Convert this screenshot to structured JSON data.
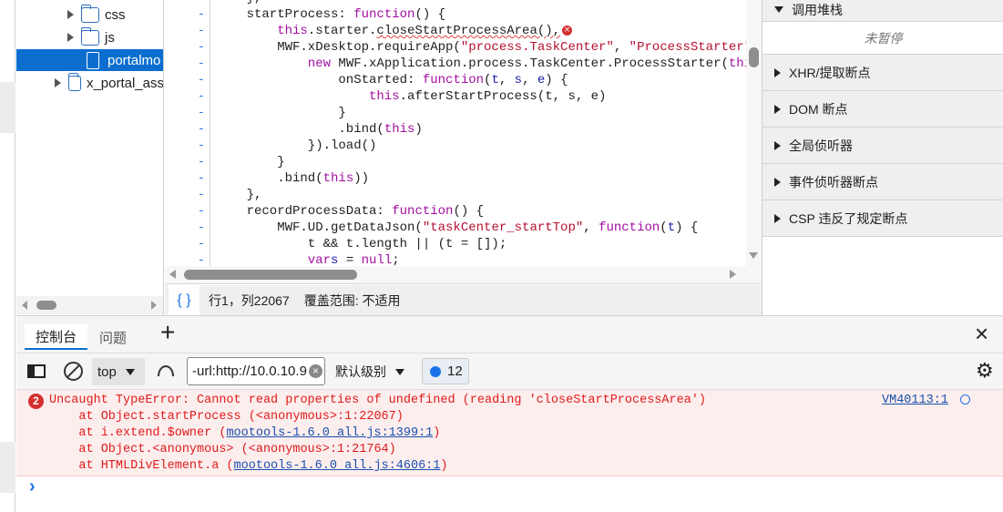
{
  "sidebar": {
    "items": [
      {
        "label": "css",
        "type": "folder"
      },
      {
        "label": "js",
        "type": "folder"
      },
      {
        "label": "portalmo",
        "type": "file"
      },
      {
        "label": "x_portal_ass",
        "type": "folder"
      }
    ]
  },
  "code": {
    "lines": [
      {
        "i": 1,
        "t": [
          [
            "",
            "},"
          ]
        ]
      },
      {
        "i": 1,
        "t": [
          [
            "",
            "startProcess: "
          ],
          [
            "k",
            "function"
          ],
          [
            "",
            "() {"
          ]
        ]
      },
      {
        "i": 2,
        "t": [
          [
            "k",
            "this"
          ],
          [
            "",
            ".starter."
          ],
          [
            "sq",
            "closeStartProcessArea(),"
          ]
        ],
        "err": true
      },
      {
        "i": 2,
        "t": [
          [
            "",
            "MWF.xDesktop.requireApp("
          ],
          [
            "s",
            "\"process.TaskCenter\""
          ],
          [
            "",
            ", "
          ],
          [
            "s",
            "\"ProcessStarter\""
          ]
        ]
      },
      {
        "i": 3,
        "t": [
          [
            "k",
            "new"
          ],
          [
            "",
            " MWF.xApplication.process.TaskCenter.ProcessStarter("
          ],
          [
            "k",
            "thi"
          ]
        ]
      },
      {
        "i": 4,
        "t": [
          [
            "",
            "onStarted: "
          ],
          [
            "k",
            "function"
          ],
          [
            "",
            "("
          ],
          [
            "p",
            "t"
          ],
          [
            "",
            ", "
          ],
          [
            "p",
            "s"
          ],
          [
            "",
            ", "
          ],
          [
            "p",
            "e"
          ],
          [
            "",
            ") {"
          ]
        ]
      },
      {
        "i": 5,
        "t": [
          [
            "k",
            "this"
          ],
          [
            "",
            ".afterStartProcess(t, s, e)"
          ]
        ]
      },
      {
        "i": 4,
        "t": [
          [
            "",
            "}"
          ]
        ]
      },
      {
        "i": 4,
        "t": [
          [
            "",
            ".bind("
          ],
          [
            "k",
            "this"
          ],
          [
            "",
            ")"
          ]
        ]
      },
      {
        "i": 3,
        "t": [
          [
            "",
            "}).load()"
          ]
        ]
      },
      {
        "i": 2,
        "t": [
          [
            "",
            "}"
          ]
        ]
      },
      {
        "i": 2,
        "t": [
          [
            "",
            ".bind("
          ],
          [
            "k",
            "this"
          ],
          [
            "",
            "))"
          ]
        ]
      },
      {
        "i": 1,
        "t": [
          [
            "",
            "},"
          ]
        ]
      },
      {
        "i": 1,
        "t": [
          [
            "",
            "recordProcessData: "
          ],
          [
            "k",
            "function"
          ],
          [
            "",
            "() {"
          ]
        ]
      },
      {
        "i": 2,
        "t": [
          [
            "",
            "MWF.UD.getDataJson("
          ],
          [
            "s",
            "\"taskCenter_startTop\""
          ],
          [
            "",
            ", "
          ],
          [
            "k",
            "function"
          ],
          [
            "",
            "("
          ],
          [
            "p",
            "t"
          ],
          [
            "",
            ") {"
          ]
        ]
      },
      {
        "i": 3,
        "t": [
          [
            "",
            "t && t.length || (t = []);"
          ]
        ]
      },
      {
        "i": 3,
        "t": [
          [
            "k",
            "var"
          ],
          [
            " ",
            ""
          ],
          [
            "p",
            "s"
          ],
          [
            "",
            " = "
          ],
          [
            "k",
            "null"
          ],
          [
            "",
            ";"
          ]
        ]
      }
    ],
    "gutter_mark": "-",
    "error_icon": "×"
  },
  "statusbar": {
    "pretty_print": "{ }",
    "position": "行1，列22067",
    "coverage": "覆盖范围: 不适用"
  },
  "right_panel": {
    "call_stack": "调用堆栈",
    "not_paused": "未暂停",
    "sections": [
      "XHR/提取断点",
      "DOM 断点",
      "全局侦听器",
      "事件侦听器断点",
      "CSP 违反了规定断点"
    ]
  },
  "drawer": {
    "tabs": [
      "控制台",
      "问题"
    ],
    "add_tab": "+",
    "close": "×",
    "toolbar": {
      "context": "top",
      "filter_value": "-url:http://10.0.10.9",
      "level": "默认级别",
      "message_count": "12"
    },
    "error": {
      "count": "2",
      "message": "Uncaught TypeError: Cannot read properties of undefined (reading 'closeStartProcessArea')",
      "source": "VM40113:1",
      "stack": [
        {
          "pre": "    at Object.startProcess (<anonymous>:1:22067)",
          "link": "",
          "post": ""
        },
        {
          "pre": "    at i.extend.$owner (",
          "link": "mootools-1.6.0_all.js:1399:1",
          "post": ")"
        },
        {
          "pre": "    at Object.<anonymous> (<anonymous>:1:21764)",
          "link": "",
          "post": ""
        },
        {
          "pre": "    at HTMLDivElement.a (",
          "link": "mootools-1.6.0_all.js:4606:1",
          "post": ")"
        }
      ]
    },
    "prompt": "›"
  },
  "colors": {
    "accent": "#0b6ecf",
    "error": "#e01b1b",
    "error_bg": "#fdeeee"
  }
}
